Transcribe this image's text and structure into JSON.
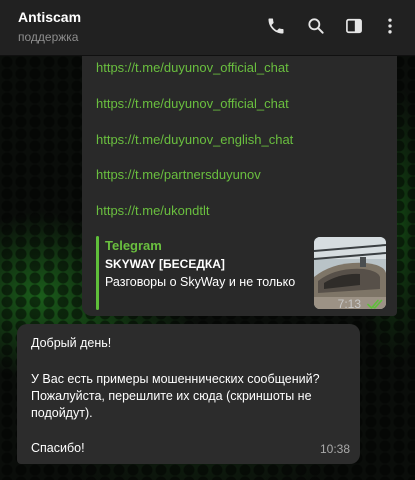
{
  "header": {
    "title": "Antiscam",
    "subtitle": "поддержка",
    "icons": [
      "phone-icon",
      "search-icon",
      "side-panel-icon",
      "more-icon"
    ]
  },
  "outgoing": {
    "links": [
      "https://t.me/duyunov_official_chat",
      "https://t.me/duyunov_official_chat",
      "https://t.me/duyunov_english_chat",
      "https://t.me/partnersduyunov",
      "https://t.me/ukondtlt"
    ],
    "preview": {
      "site": "Telegram",
      "title": "SKYWAY [БЕСЕДКА]",
      "description": "Разговоры о SkyWay и не только"
    },
    "time": "7:13",
    "status": "read"
  },
  "incoming": {
    "lines": [
      "Добрый день!",
      "У Вас есть примеры мошеннических сообщений?",
      "Пожалуйста, перешлите их сюда (скриншоты не",
      "подойдут).",
      "Спасибо!"
    ],
    "time": "10:38"
  },
  "colors": {
    "link": "#6abf3f",
    "bubble": "#2c2c2c",
    "header": "#212121",
    "read_ticks": "#5fbf3a"
  }
}
